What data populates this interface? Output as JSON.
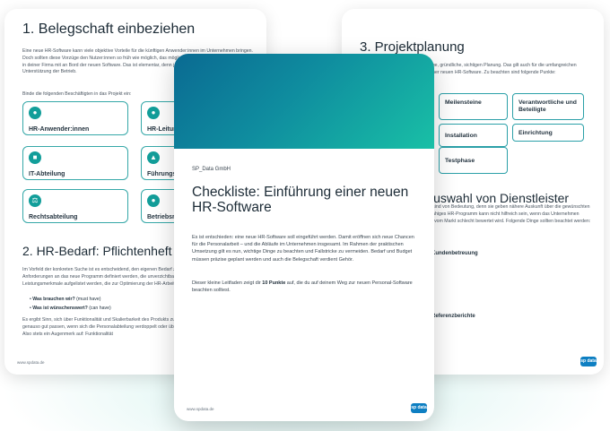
{
  "left_page": {
    "heading1": "1. Belegschaft einbeziehen",
    "intro": "Eine neue HR-Software kann viele objektive Vorteile für die künftigen Anwender:innen im Unternehmen bringen. Doch sollten diese Vorzüge den Nutzer:innen so früh wie möglich, das möglichst frühzeitig. Nimm die Betroffenen in deiner Firma mit an Bord der neuen Software. Das ist elementar, denn jedes Projekt stirbt ohne die Unterstützung der Betrieb.",
    "list_intro": "Binde die folgenden Beschäftigten in das Projekt ein:",
    "tiles": [
      {
        "label": "HR-Anwender:innen",
        "icon": "person-icon"
      },
      {
        "label": "HR-Leitung",
        "icon": "team-icon"
      },
      {
        "label": "IT-Abteilung",
        "icon": "chip-icon"
      },
      {
        "label": "Führungsebene",
        "icon": "hierarchy-icon"
      },
      {
        "label": "Rechtsabteilung",
        "icon": "scales-icon"
      },
      {
        "label": "Betriebsrat",
        "icon": "council-icon"
      }
    ],
    "heading2": "2. HR-Bedarf: Pflichtenheft vs.",
    "para2": "Im Vorfeld der konkreten Suche ist es entscheidend, den eigenen Bedarf zu kennen. Dazu gehört zunächst jene Anforderungen an das neue Programm definiert werden, die unverzichtbar sind. In einem zweiten Schritt können Leistungsmerkmale aufgelistet werden, die zur Optimierung der HR-Arbeit wünschenswert sind.",
    "bullet1_bold": "Was brauchen wir?",
    "bullet1_rest": " (must have)",
    "bullet2_bold": "Was ist wünschenswert?",
    "bullet2_rest": " (can have)",
    "para3": "Es ergibt Sinn, sich über Funktionalität und Skalierbarkeit des Produkts zu informieren. Kann die Software noch genauso gut passen, wenn sich die Personalabteilung verdoppelt oder über mehrere Standorte verteilt würde? Also stets ein Augenmerk auf: Funktionalität",
    "footer": "www.spdata.de",
    "logo": "sp data"
  },
  "right_page": {
    "heading1": "3. Projektplanung",
    "para1": "Jedes Projekt braucht eine vernünftige, gründliche, sichtigen Planung. Das gilt auch für die umfangreichen Aufgaben rund um die Einführung einer neuen HR-Software. Zu beachten sind folgende Punkte:",
    "tiles": [
      "Meilensteine",
      "Verantwortliche und Beteiligte",
      "Installation",
      "Einrichtung",
      "Testphase"
    ],
    "heading2": "4. Auswahl von Dienstleister",
    "para2": "Die Wahl des richtigen Dienstleister sind von Bedeutung, denn sie geben nähere Auskunft über die gewünschten Leistungen. Auch ein sehr leistungsfähiges HR-Programm kann nicht hilfreich sein, wenn das Unternehmen dahinter etwa von Nutzer:innen oder vom Markt schlecht bewertet wird. Folgende Dinge sollten beachtet werden:",
    "item1": "Kundenbetreuung",
    "item2": "Referenzberichte",
    "logo": "sp data"
  },
  "center_page": {
    "company": "SP_Data GmbH",
    "title": "Checkliste: Einführung einer neuen HR-Software",
    "para1": "Es ist entschieden: eine neue HR-Software soll eingeführt werden. Damit eröffnen sich neue Chancen für die Personalarbeit – und die Abläufe im Unternehmen insgesamt. Im Rahmen der praktischen Umsetzung gilt es nun, wichtige Dinge zu beachten und Fallstricke zu vermeiden. Bedarf und Budget müssen präzise geplant werden und auch die Belegschaft verdient Gehör.",
    "para2_a": "Dieser kleine Leitfaden zeigt dir ",
    "para2_bold": "10 Punkte",
    "para2_b": " auf, die du auf deinem Weg zur neuen Personal-Software beachten solltest.",
    "footer": "www.spdata.de",
    "logo": "sp data"
  }
}
